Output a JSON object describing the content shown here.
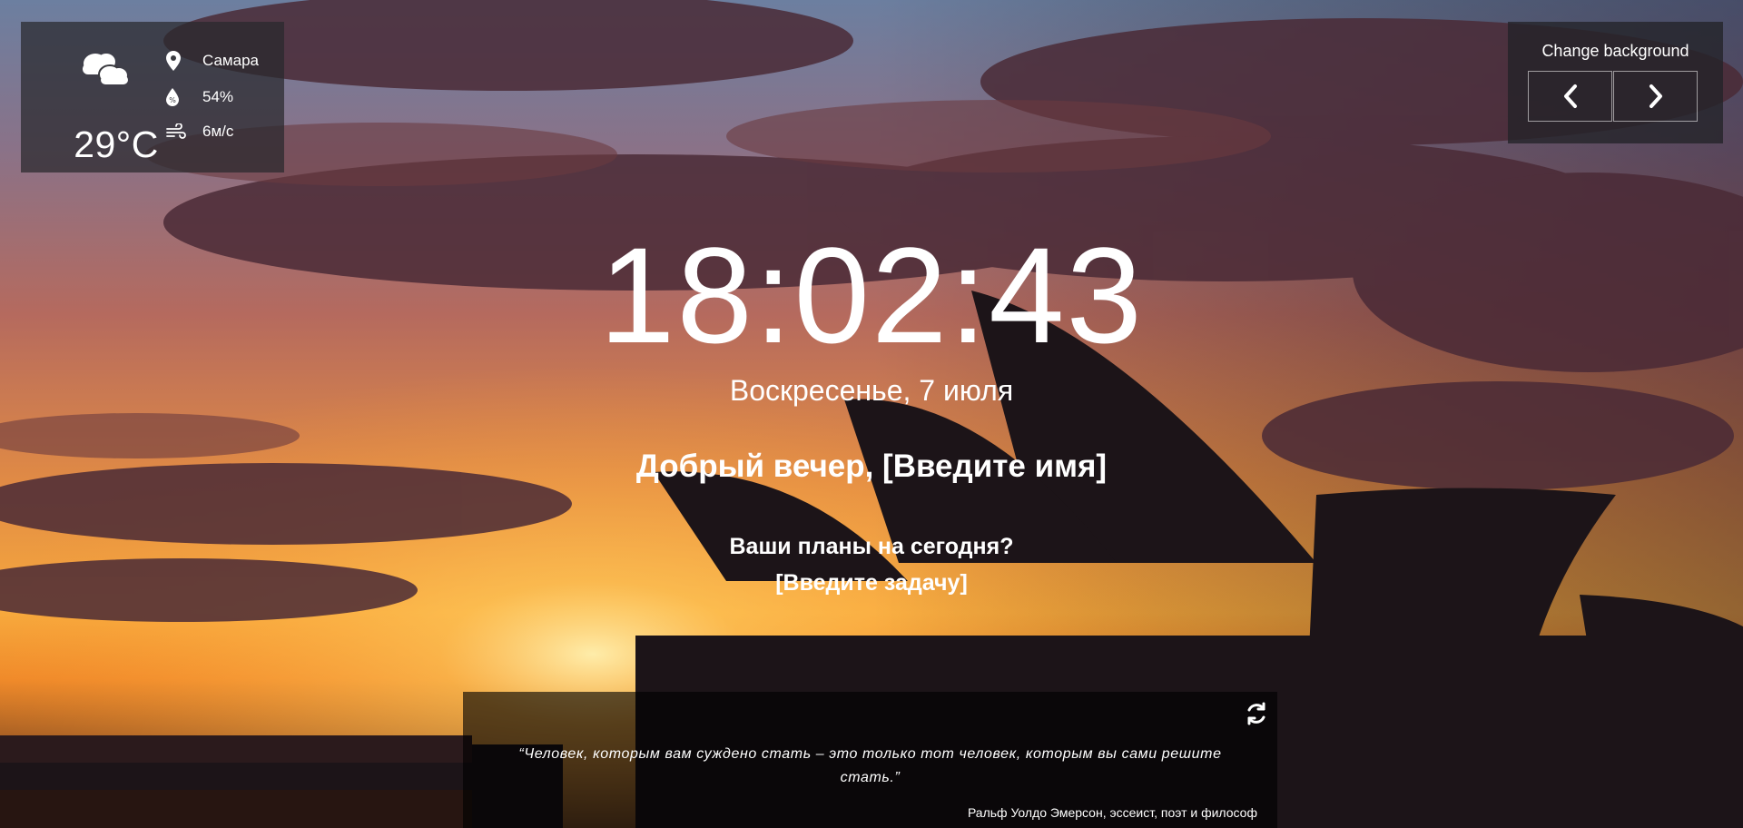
{
  "weather": {
    "icon": "cloudy-icon",
    "temperature": "29°C",
    "city": "Самара",
    "humidity": "54%",
    "wind": "6м/с"
  },
  "background_controls": {
    "title": "Change background",
    "prev_icon": "chevron-left-icon",
    "next_icon": "chevron-right-icon"
  },
  "clock": {
    "time": "18:02:43",
    "date": "Воскресенье, 7 июля"
  },
  "greeting": {
    "text": "Добрый вечер, [Введите имя]"
  },
  "focus": {
    "question": "Ваши планы на сегодня?",
    "task": "[Введите задачу]"
  },
  "quote": {
    "text": "“Человек, которым вам суждено стать – это только тот человек, которым вы сами решите стать.”",
    "author": "Ральф Уолдо Эмерсон, эссеист, поэт и философ",
    "refresh_icon": "refresh-icon"
  },
  "colors": {
    "panel": "#28282d",
    "sunset_orange": "#f29a3c",
    "sky_purple": "#5e3a4e"
  }
}
